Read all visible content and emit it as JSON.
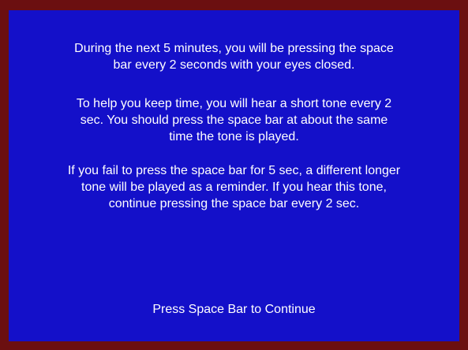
{
  "instructions": {
    "paragraph_1": "During the next 5 minutes, you will be pressing the space\nbar every 2 seconds with your eyes closed.",
    "paragraph_2": "To help you keep time, you will hear a short tone every 2\nsec.  You should press the space bar at about the same\ntime the tone is played.",
    "paragraph_3": "If you fail to press the space bar for 5 sec, a different longer\ntone will be played as a reminder.  If you hear this tone,\ncontinue pressing the space bar every 2 sec."
  },
  "prompt": {
    "continue_label": "Press Space Bar to Continue"
  },
  "colors": {
    "background": "#1410c9",
    "border": "#6b0f10",
    "text": "#ffffff"
  }
}
